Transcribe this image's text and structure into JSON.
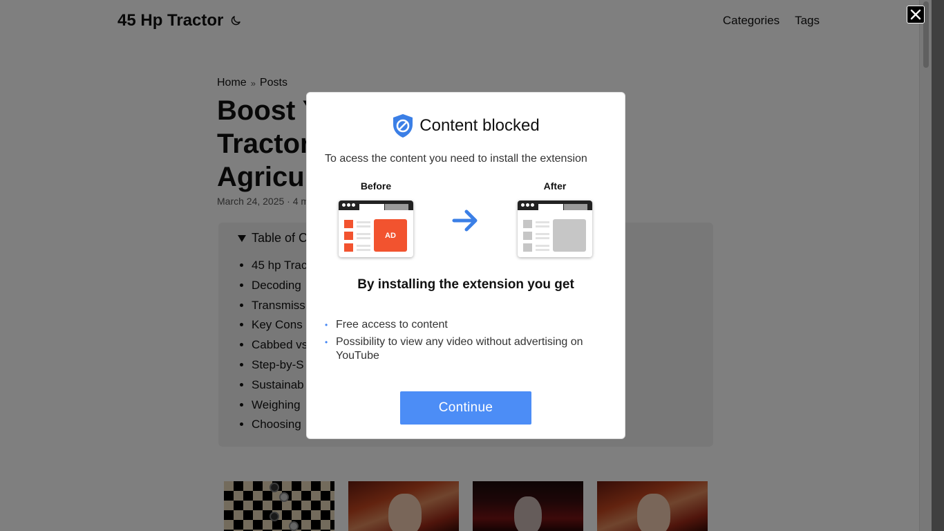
{
  "header": {
    "site_title": "45 Hp Tractor",
    "nav": [
      "Categories",
      "Tags"
    ]
  },
  "breadcrumb": {
    "home": "Home",
    "separator": "»",
    "posts": "Posts"
  },
  "post": {
    "title_lines": [
      "Boost Y",
      "Tractor",
      "Agricu"
    ],
    "meta": "March 24, 2025 · 4 m"
  },
  "toc": {
    "summary": "Table of C",
    "items": [
      "45 hp Trac",
      "Decoding",
      "Transmiss",
      "Key Cons",
      "Cabbed vs",
      "Step-by-S",
      "Sustainab",
      "Weighing",
      "Choosing"
    ]
  },
  "modal": {
    "title": "Content blocked",
    "description": "To acess the content you need to install the extension",
    "before_label": "Before",
    "after_label": "After",
    "ad_text": "AD",
    "benefits_title": "By installing the extension you get",
    "benefits": [
      "Free access to content",
      "Possibility to view any video without advertising on YouTube"
    ],
    "bullet": "•",
    "continue_label": "Continue"
  },
  "colors": {
    "accent_blue": "#4c8df6",
    "ad_orange": "#f2532f",
    "placeholder_gray": "#c6c6c6",
    "overlay": "rgba(0,0,0,0.5)"
  },
  "icons": [
    "moon-icon",
    "close-icon",
    "shield-block-icon",
    "arrow-right-icon"
  ]
}
